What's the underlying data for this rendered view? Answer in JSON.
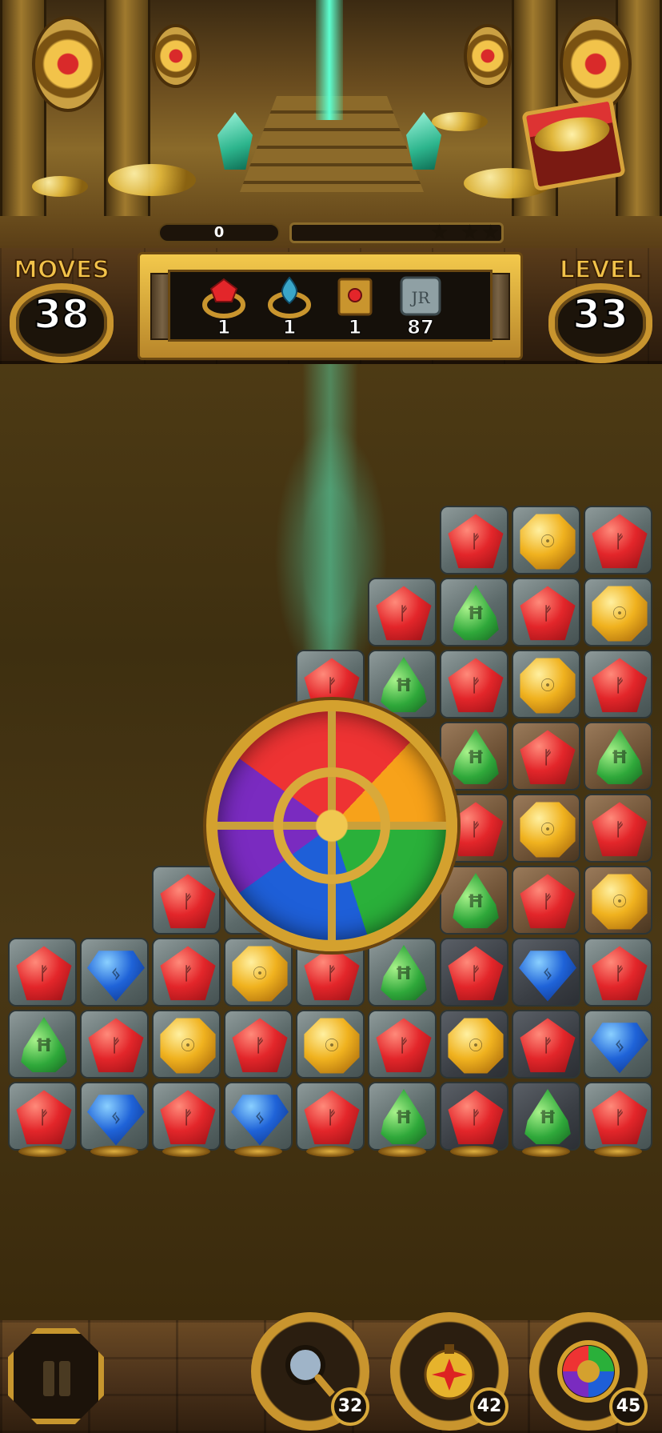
{
  "score": {
    "value": "0"
  },
  "progress": {
    "fraction": 0.0,
    "stars_total": 3
  },
  "hud": {
    "moves_label": "MOVES",
    "moves_value": "38",
    "level_label": "LEVEL",
    "level_value": "33"
  },
  "goals": [
    {
      "icon": "red-gem-ring-icon",
      "count": "1"
    },
    {
      "icon": "blue-gem-ring-icon",
      "count": "1"
    },
    {
      "icon": "spell-book-icon",
      "count": "1"
    },
    {
      "icon": "stone-tile-icon",
      "count": "87"
    }
  ],
  "board": {
    "rows": [
      [
        "",
        "",
        "",
        "",
        "",
        "red",
        "yellow",
        "red"
      ],
      [
        "",
        "",
        "",
        "",
        "red",
        "green",
        "red",
        "yellow"
      ],
      [
        "",
        "",
        "",
        "red",
        "green",
        "red",
        "yellow",
        "red"
      ],
      [
        "",
        "",
        "",
        "",
        "",
        "green",
        "red",
        "green"
      ],
      [
        "",
        "",
        "red",
        "",
        "",
        "red",
        "yellow",
        "red"
      ],
      [
        "",
        "red",
        "blue",
        "",
        "",
        "green",
        "red",
        "yellow"
      ],
      [
        "red",
        "blue",
        "red",
        "yellow",
        "red",
        "green",
        "red",
        "blue",
        "red"
      ],
      [
        "green",
        "red",
        "yellow",
        "red",
        "yellow",
        "red",
        "yellow",
        "red",
        "blue"
      ],
      [
        "red",
        "blue",
        "red",
        "blue",
        "red",
        "green",
        "red",
        "green",
        "red"
      ]
    ]
  },
  "boosters": [
    {
      "name": "magnifier-booster",
      "count": "32"
    },
    {
      "name": "bomb-booster",
      "count": "42"
    },
    {
      "name": "rainbow-medallion-booster",
      "count": "45"
    }
  ],
  "colors": {
    "gold": "#c9952e",
    "red_gem": "#e3262a",
    "green_gem": "#2fa83a",
    "yellow_gem": "#f0b21f",
    "blue_gem": "#1f63d8"
  }
}
